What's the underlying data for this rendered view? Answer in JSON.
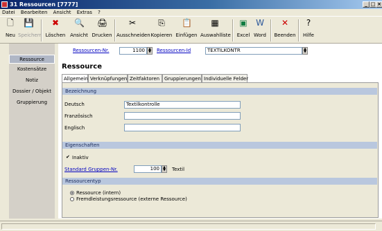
{
  "window": {
    "title": "31 Ressourcen [7777]"
  },
  "menu": [
    "Datei",
    "Bearbeiten",
    "Ansicht",
    "Extras",
    "?"
  ],
  "toolbar": {
    "new": "Neu",
    "save": "Speichern",
    "delete": "Löschen",
    "view": "Ansicht",
    "print": "Drucken",
    "cut": "Ausschneiden",
    "copy": "Kopieren",
    "paste": "Einfügen",
    "selection_list": "Auswahlliste",
    "excel": "Excel",
    "word": "Word",
    "quit": "Beenden",
    "help": "Hilfe"
  },
  "sidebar": {
    "items": [
      {
        "label": "Ressource"
      },
      {
        "label": "Kostensätze"
      },
      {
        "label": "Notiz"
      },
      {
        "label": "Dossier / Objekt"
      },
      {
        "label": "Gruppierung"
      }
    ]
  },
  "header": {
    "number_label": "Ressourcen-Nr.",
    "number_value": "1100",
    "id_label": "Ressourcen-Id",
    "id_value": "TEXTILKONTR"
  },
  "main": {
    "heading": "Ressource",
    "tabs": [
      "Allgemein",
      "Verknüpfungen",
      "Zeitfaktoren",
      "Gruppierungen",
      "Individuelle Felder"
    ]
  },
  "bezeichnung": {
    "section": "Bezeichnung",
    "deutsch_label": "Deutsch",
    "deutsch_value": "Textilkontrolle",
    "franz_label": "Französisch",
    "franz_value": "",
    "englisch_label": "Englisch",
    "englisch_value": ""
  },
  "eigenschaften": {
    "section": "Eigenschaften",
    "inaktiv_label": "Inaktiv",
    "gruppe_label": "Standard Gruppen-Nr.",
    "gruppe_value": "100",
    "gruppe_name": "Textil"
  },
  "ressourcentyp": {
    "section": "Ressourcentyp",
    "option1": "Ressource (intern)",
    "option2": "Fremdleistungsressource (externe Ressource)"
  }
}
